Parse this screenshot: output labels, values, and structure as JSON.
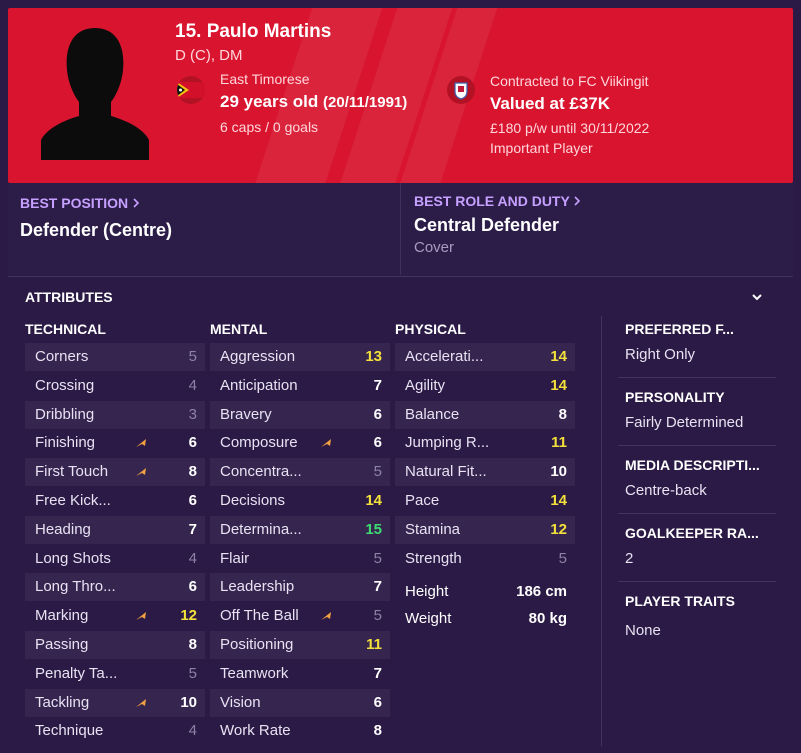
{
  "player": {
    "name": "15. Paulo Martins",
    "positions": "D (C), DM",
    "nationality": "East Timorese",
    "age": "29 years old",
    "dob": "(20/11/1991)",
    "caps": "6 caps / 0 goals",
    "contract": "Contracted to FC Viikingit",
    "value": "Valued at £37K",
    "wage": "£180 p/w until 30/11/2022",
    "status": "Important Player"
  },
  "best_position": {
    "label": "BEST POSITION",
    "value": "Defender (Centre)"
  },
  "best_role": {
    "label": "BEST ROLE AND DUTY",
    "value": "Central Defender",
    "duty": "Cover"
  },
  "attributes": {
    "title": "ATTRIBUTES",
    "technical": {
      "heading": "TECHNICAL",
      "items": [
        {
          "label": "Corners",
          "value": "5"
        },
        {
          "label": "Crossing",
          "value": "4"
        },
        {
          "label": "Dribbling",
          "value": "3"
        },
        {
          "label": "Finishing",
          "value": "6"
        },
        {
          "label": "First Touch",
          "value": "8"
        },
        {
          "label": "Free Kick...",
          "value": "6"
        },
        {
          "label": "Heading",
          "value": "7"
        },
        {
          "label": "Long Shots",
          "value": "4"
        },
        {
          "label": "Long Thro...",
          "value": "6"
        },
        {
          "label": "Marking",
          "value": "12"
        },
        {
          "label": "Passing",
          "value": "8"
        },
        {
          "label": "Penalty Ta...",
          "value": "5"
        },
        {
          "label": "Tackling",
          "value": "10"
        },
        {
          "label": "Technique",
          "value": "4"
        }
      ]
    },
    "mental": {
      "heading": "MENTAL",
      "items": [
        {
          "label": "Aggression",
          "value": "13"
        },
        {
          "label": "Anticipation",
          "value": "7"
        },
        {
          "label": "Bravery",
          "value": "6"
        },
        {
          "label": "Composure",
          "value": "6"
        },
        {
          "label": "Concentra...",
          "value": "5"
        },
        {
          "label": "Decisions",
          "value": "14"
        },
        {
          "label": "Determina...",
          "value": "15"
        },
        {
          "label": "Flair",
          "value": "5"
        },
        {
          "label": "Leadership",
          "value": "7"
        },
        {
          "label": "Off The Ball",
          "value": "5"
        },
        {
          "label": "Positioning",
          "value": "11"
        },
        {
          "label": "Teamwork",
          "value": "7"
        },
        {
          "label": "Vision",
          "value": "6"
        },
        {
          "label": "Work Rate",
          "value": "8"
        }
      ]
    },
    "physical": {
      "heading": "PHYSICAL",
      "items": [
        {
          "label": "Accelerati...",
          "value": "14"
        },
        {
          "label": "Agility",
          "value": "14"
        },
        {
          "label": "Balance",
          "value": "8"
        },
        {
          "label": "Jumping R...",
          "value": "11"
        },
        {
          "label": "Natural Fit...",
          "value": "10"
        },
        {
          "label": "Pace",
          "value": "14"
        },
        {
          "label": "Stamina",
          "value": "12"
        },
        {
          "label": "Strength",
          "value": "5"
        }
      ],
      "height_label": "Height",
      "height": "186 cm",
      "weight_label": "Weight",
      "weight": "80 kg"
    }
  },
  "side": {
    "preferred_foot_title": "PREFERRED F...",
    "preferred_foot": "Right Only",
    "personality_title": "PERSONALITY",
    "personality": "Fairly Determined",
    "media_title": "MEDIA DESCRIPTI...",
    "media": "Centre-back",
    "gk_title": "GOALKEEPER RA...",
    "gk": "2",
    "traits_title": "PLAYER TRAITS",
    "traits": "None"
  },
  "colors": {
    "header": "#d8142e",
    "background": "#2a1a45",
    "link": "#c6a0ff",
    "good": "#f3e03a",
    "great": "#3ddc72",
    "arrow": "#f0a040"
  }
}
